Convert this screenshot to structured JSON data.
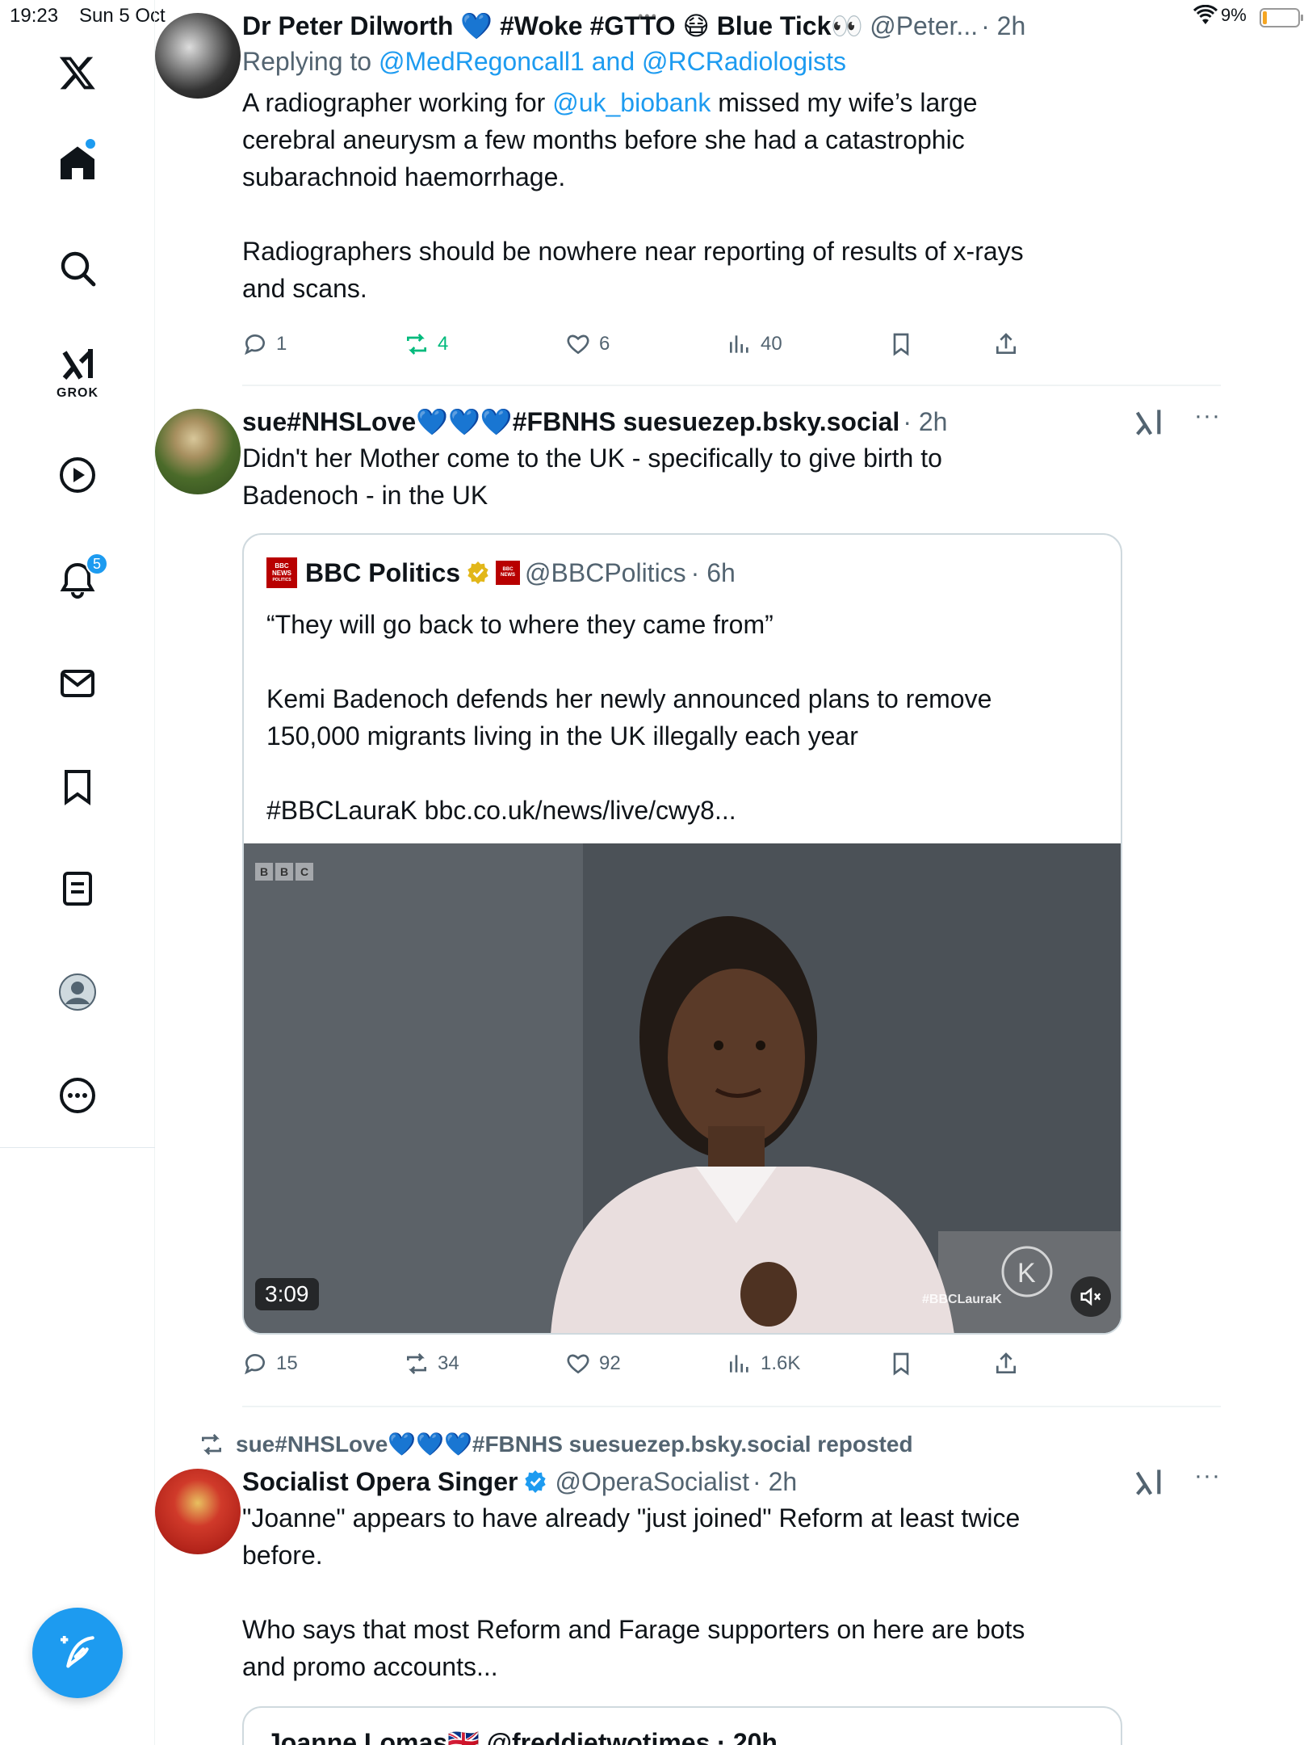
{
  "status_bar": {
    "time": "19:23",
    "date": "Sun 5 Oct",
    "battery": "9%"
  },
  "sidebar": {
    "items": [
      {
        "name": "x-logo",
        "label": ""
      },
      {
        "name": "home",
        "label": ""
      },
      {
        "name": "search",
        "label": ""
      },
      {
        "name": "grok",
        "label": "GROK"
      },
      {
        "name": "video",
        "label": ""
      },
      {
        "name": "notifications",
        "label": "",
        "badge": "5"
      },
      {
        "name": "messages",
        "label": ""
      },
      {
        "name": "bookmarks",
        "label": ""
      },
      {
        "name": "lists",
        "label": ""
      },
      {
        "name": "profile",
        "label": ""
      },
      {
        "name": "more",
        "label": ""
      }
    ],
    "notification_badge": "5",
    "grok_label": "GROK"
  },
  "tweets": [
    {
      "display_name": "Dr Peter Dilworth 💙 #Woke #GTTO 😷 Blue Tick👀",
      "handle": "@Peter...",
      "time": "· 2h",
      "replying_prefix": "Replying to ",
      "replying_to": "@MedRegoncall1 and @RCRadiologists",
      "text_prefix": "A radiographer working for ",
      "mention": "@uk_biobank",
      "text_suffix": " missed my wife’s large\ncerebral aneurysm a few months before she had a catastrophic\nsubarachnoid haemorrhage.\n\nRadiographers should be nowhere near reporting of results of x-rays\nand scans.",
      "stats": {
        "replies": "1",
        "reposts": "4",
        "likes": "6",
        "views": "40"
      }
    },
    {
      "display_name": "sue#NHSLove💙💙💙#FBNHS suesuezep.bsky.social",
      "handle": "",
      "time": "· 2h",
      "text": "Didn't her Mother come to the UK - specifically to give birth to\nBadenoch - in the UK",
      "more": "···",
      "quote": {
        "display_name": "BBC Politics",
        "handle": "@BBCPolitics",
        "time": "· 6h",
        "logo_line1": "BBC",
        "logo_line2": "NEWS",
        "logo_line3": "POLITICS",
        "text": "“They will go back to where they came from”\n\nKemi Badenoch defends her newly announced plans to remove\n150,000 migrants living in the UK illegally each year\n\n#BBCLauraK bbc.co.uk/news/live/cwy8...",
        "video_duration": "3:09",
        "video_watermark": "#BBCLauraK",
        "video_bbc_letters": [
          "B",
          "B",
          "C"
        ]
      },
      "stats": {
        "replies": "15",
        "reposts": "34",
        "likes": "92",
        "views": "1.6K"
      }
    },
    {
      "repost_label": "sue#NHSLove💙💙💙#FBNHS suesuezep.bsky.social reposted",
      "display_name": "Socialist Opera Singer",
      "handle": "@OperaSocialist",
      "time": "· 2h",
      "more": "···",
      "text": "\"Joanne\" appears to have already \"just joined\" Reform at least twice\nbefore.\n\nWho says that most Reform and Farage supporters on here are bots\nand promo accounts...",
      "next_quote_partial": "Joanne Lomas🇬🇧 @freddietwotimes · 20h"
    }
  ],
  "colors": {
    "accent": "#1d9bf0",
    "text": "#0f1419",
    "secondary": "#536471",
    "retweet_active": "#00ba7c",
    "border": "#eff3f4"
  }
}
